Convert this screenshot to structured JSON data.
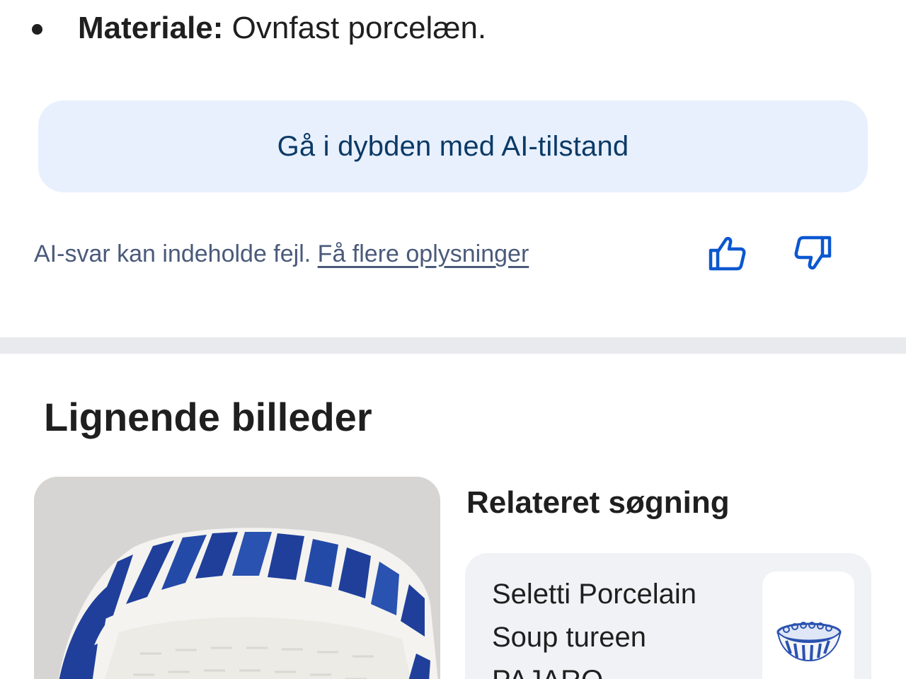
{
  "bullet": {
    "label": "Materiale:",
    "text": " Ovnfast porcelæn."
  },
  "ai_mode_button": {
    "label": "Gå i dybden med AI-tilstand"
  },
  "disclaimer": {
    "text": "AI-svar kan indeholde fejl. ",
    "link": "Få flere oplysninger"
  },
  "feedback": {
    "thumbs_up_icon": "thumbs-up-icon",
    "thumbs_down_icon": "thumbs-down-icon"
  },
  "similar_images": {
    "title": "Lignende billeder"
  },
  "related": {
    "heading": "Relateret søgning",
    "card": {
      "lines": [
        "Seletti Porcelain",
        "Soup tureen",
        "PAJARO"
      ]
    }
  },
  "colors": {
    "ai_button_bg": "#e8f0fe",
    "ai_button_text": "#0b3a66",
    "icon_blue": "#0b57d0",
    "disclaimer_text": "#4a5a7a",
    "divider": "#e8eaed",
    "related_card_bg": "#f0f2f5",
    "porcelain_blue": "#1f3f9a"
  }
}
